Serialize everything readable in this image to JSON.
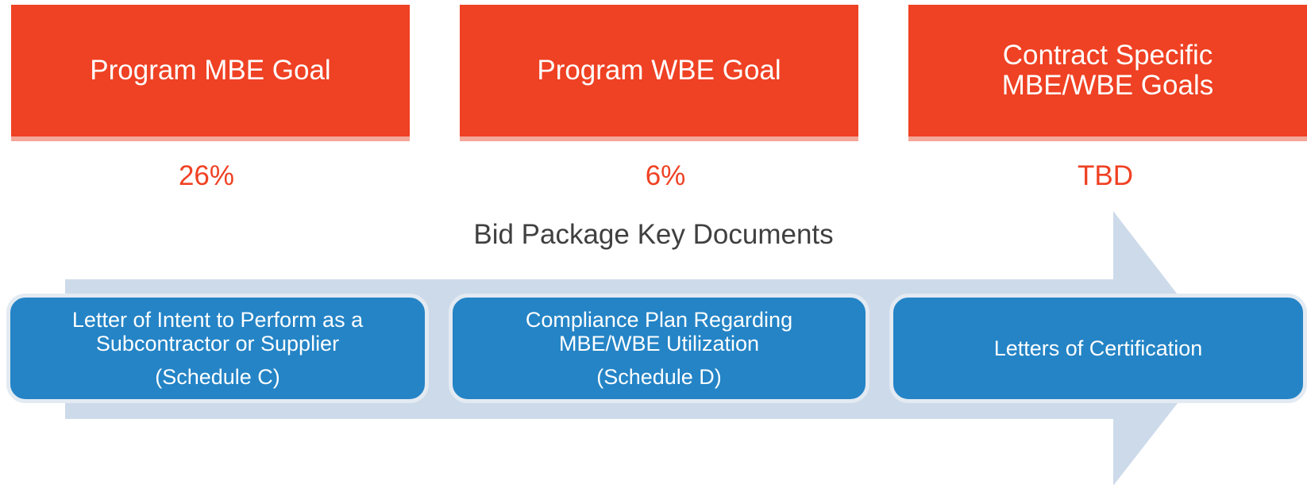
{
  "goals": [
    {
      "label": "Program MBE Goal",
      "value": "26%"
    },
    {
      "label": "Program WBE Goal",
      "value": "6%"
    },
    {
      "label": "Contract Specific MBE/WBE Goals",
      "value": "TBD"
    }
  ],
  "documents": {
    "title": "Bid Package Key Documents",
    "items": [
      {
        "title": "Letter of Intent to Perform as a Subcontractor or Supplier",
        "schedule": "(Schedule C)"
      },
      {
        "title": "Compliance Plan Regarding MBE/WBE Utilization",
        "schedule": "(Schedule D)"
      },
      {
        "title": "Letters of Certification",
        "schedule": ""
      }
    ]
  },
  "colors": {
    "goal_box": "#EF4123",
    "goal_value": "#EF4123",
    "doc_box": "#2484C6",
    "arrow": "#CDDAEA",
    "title_text": "#404040"
  }
}
